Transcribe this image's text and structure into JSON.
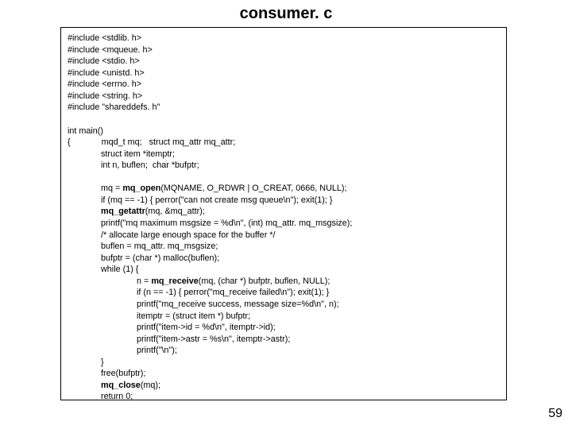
{
  "title": "consumer. c",
  "page_number": "59",
  "code": {
    "includes": [
      "#include <stdlib. h>",
      "#include <mqueue. h>",
      "#include <stdio. h>",
      "#include <unistd. h>",
      "#include <errno. h>",
      "#include <string. h>",
      "#include \"shareddefs. h\""
    ],
    "l_main": "int main()",
    "l_open_brace": "{",
    "decl1": "mqd_t mq;   struct mq_attr mq_attr;",
    "decl2": "struct item *itemptr;",
    "decl3": "int n, buflen;  char *bufptr;",
    "s1a": "mq = ",
    "s1b": "mq_open",
    "s1c": "(MQNAME, O_RDWR | O_CREAT, 0666, NULL);",
    "s2": "if (mq == -1) { perror(\"can not create msg queue\\n\"); exit(1); }",
    "s3a": "mq_getattr",
    "s3b": "(mq, &mq_attr);",
    "s4": "printf(\"mq maximum msgsize = %d\\n\", (int) mq_attr. mq_msgsize);",
    "s5": "/* allocate large enough space for the buffer */",
    "s6": "buflen = mq_attr. mq_msgsize;",
    "s7": "bufptr = (char *) malloc(buflen);",
    "s8": "while (1) {",
    "w1a": "n = ",
    "w1b": "mq_receive",
    "w1c": "(mq, (char *) bufptr, buflen, NULL);",
    "w2": "if (n == -1) { perror(\"mq_receive failed\\n\"); exit(1); }",
    "w3": "printf(\"mq_receive success, message size=%d\\n\", n);",
    "w4": "itemptr = (struct item *) bufptr;",
    "w5": "printf(\"item->id = %d\\n\", itemptr->id);",
    "w6": "printf(\"item->astr = %s\\n\", itemptr->astr);",
    "w7": "printf(\"\\n\");",
    "s9": "}",
    "s10": "free(bufptr);",
    "s11a": "mq_close",
    "s11b": "(mq);",
    "s12": "return 0;",
    "l_close_brace": "}"
  }
}
